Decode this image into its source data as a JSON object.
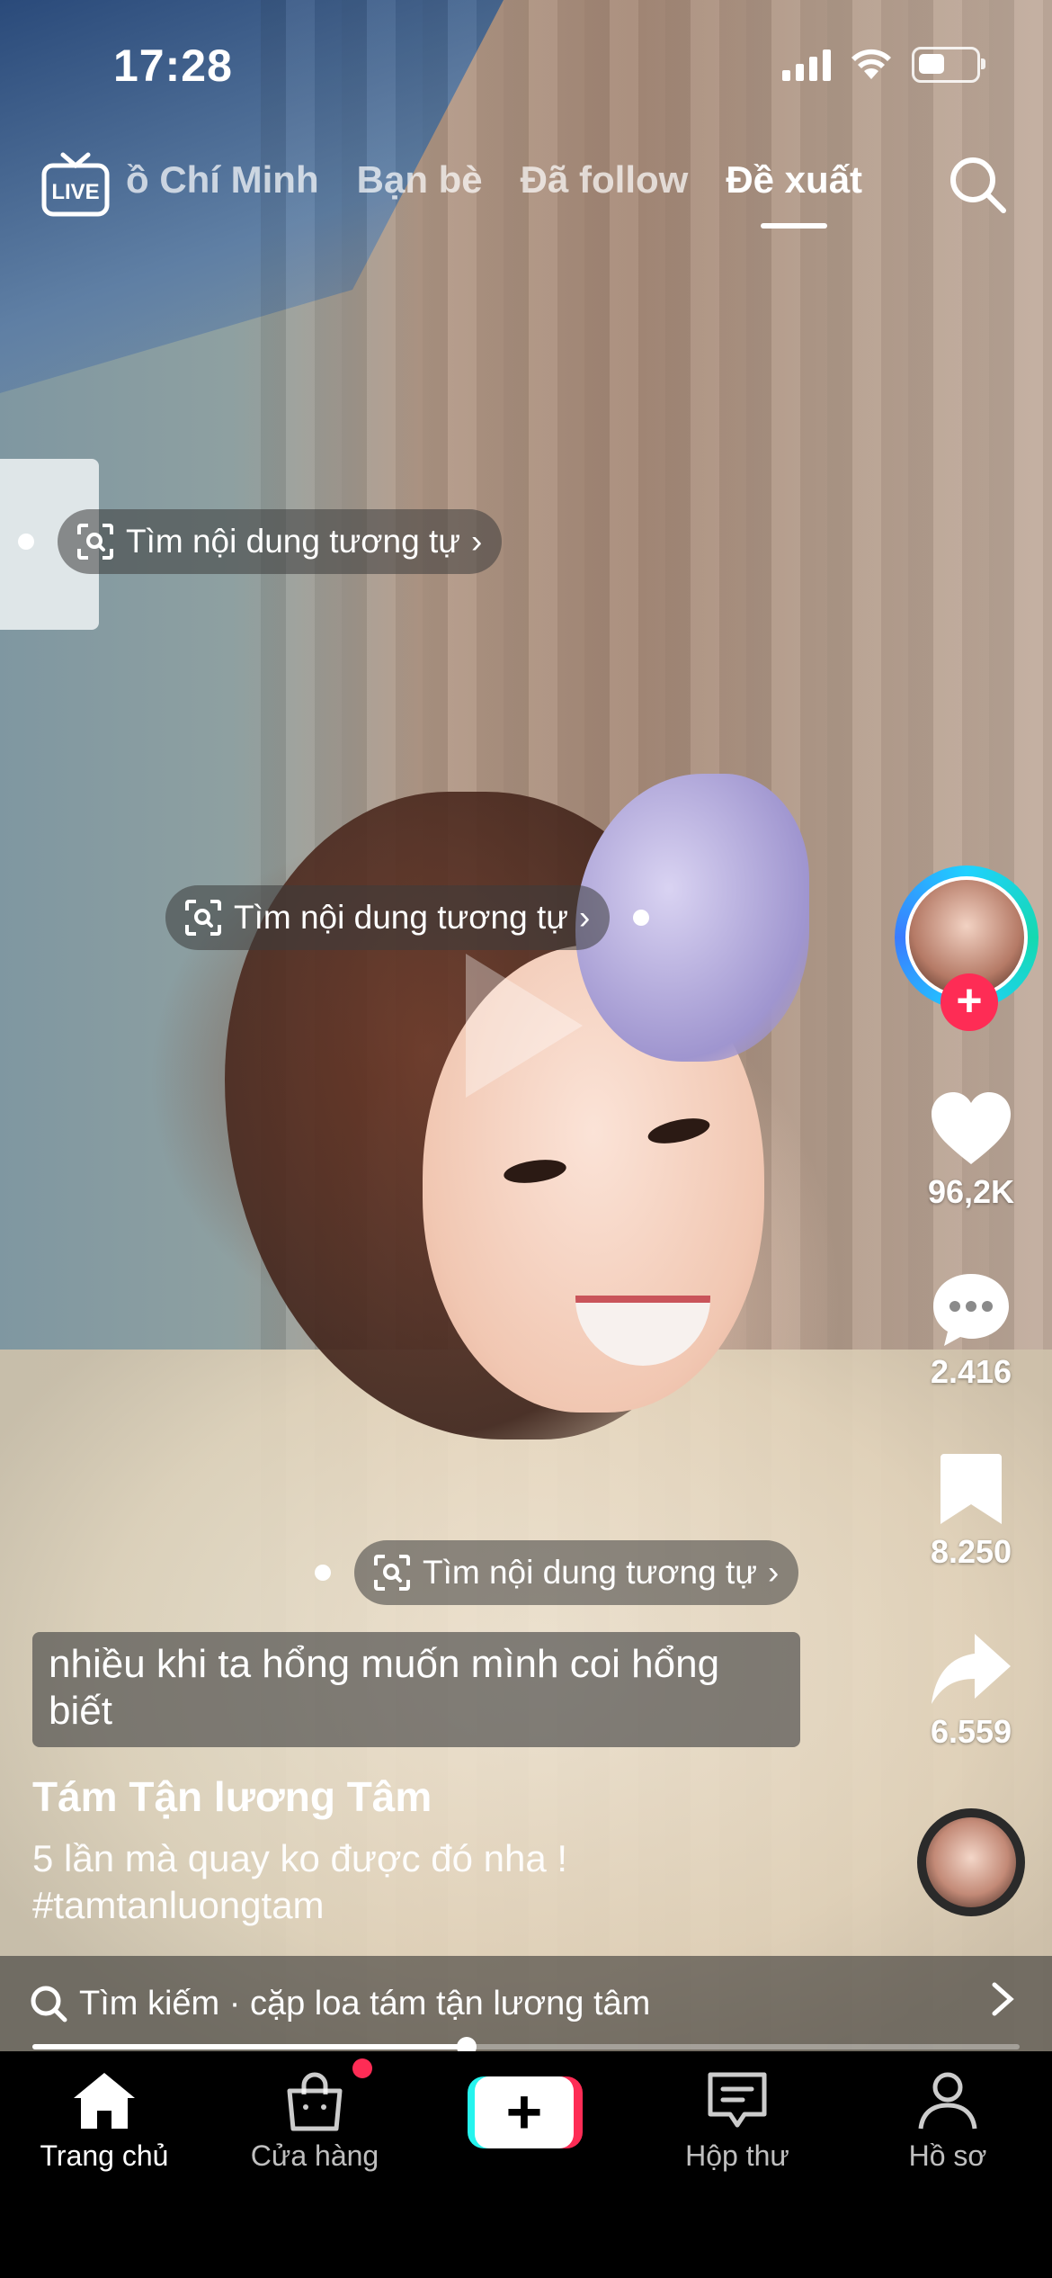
{
  "status_bar": {
    "time": "17:28"
  },
  "top_nav": {
    "live_label": "LIVE",
    "tabs": [
      {
        "label": "ồ Chí Minh",
        "active": false
      },
      {
        "label": "Bạn bè",
        "active": false
      },
      {
        "label": "Đã follow",
        "active": false
      },
      {
        "label": "Đề xuất",
        "active": true
      }
    ]
  },
  "similar_pills": [
    {
      "label": "Tìm nội dung tương tự"
    },
    {
      "label": "Tìm nội dung tương tự"
    },
    {
      "label": "Tìm nội dung tương tự"
    }
  ],
  "right_rail": {
    "likes": "96,2K",
    "comments": "2.416",
    "saves": "8.250",
    "shares": "6.559"
  },
  "caption": {
    "sticker_text": "nhiều khi ta hổng muốn mình coi hổng biết",
    "author": "Tám Tận lương Tâm",
    "description": "5 lần mà quay ko được đó nha !",
    "hashtag": "#tamtanluongtam"
  },
  "search_bar": {
    "text": "Tìm kiếm · cặp loa tám tận lương tâm"
  },
  "playback": {
    "progress_fraction": 0.44
  },
  "bottom_nav": {
    "items": [
      {
        "label": "Trang chủ",
        "icon": "home-icon",
        "active": true
      },
      {
        "label": "Cửa hàng",
        "icon": "shopping-bag-icon",
        "active": false
      },
      {
        "label": "Hộp thư",
        "icon": "inbox-icon",
        "active": false
      },
      {
        "label": "Hồ sơ",
        "icon": "profile-icon",
        "active": false
      }
    ]
  },
  "colors": {
    "accent_red": "#fe2c55",
    "accent_cyan": "#25f4ee"
  }
}
